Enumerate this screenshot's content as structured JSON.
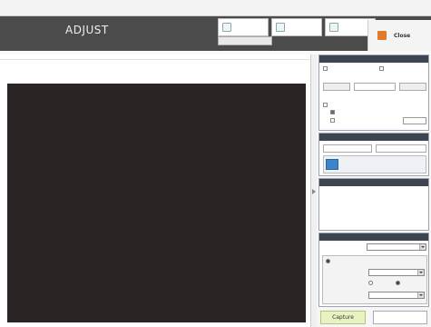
{
  "menubar": {
    "items": [
      "",
      "",
      "",
      "",
      "",
      ""
    ]
  },
  "header": {
    "title": "ADJUST",
    "subtitle": "",
    "info": [
      "",
      "",
      "",
      ""
    ],
    "buttons": [
      "",
      "",
      ""
    ],
    "wide_button": "",
    "close_label": "Close"
  },
  "preview": {
    "label": ""
  },
  "panel": {
    "image_section": {
      "title": "",
      "checkbox1": "",
      "checkbox2": "",
      "button_mid": "",
      "option1": "",
      "option2": "",
      "option3": ""
    },
    "list_section": {
      "title": "",
      "btn_left": "",
      "btn_right": "",
      "item_label": ""
    },
    "result_section": {
      "title": "",
      "line1": "",
      "line2": ""
    },
    "display_section": {
      "title": "",
      "size_label": "",
      "size_value": "",
      "radio_label": "",
      "radio_right": "",
      "r1_label": "",
      "r1_value": "",
      "r2_label": "",
      "r2_on": "",
      "r2_off": "",
      "r3_label": "",
      "r3_value": ""
    }
  },
  "footer": {
    "capture": "Capture",
    "stop": ""
  }
}
